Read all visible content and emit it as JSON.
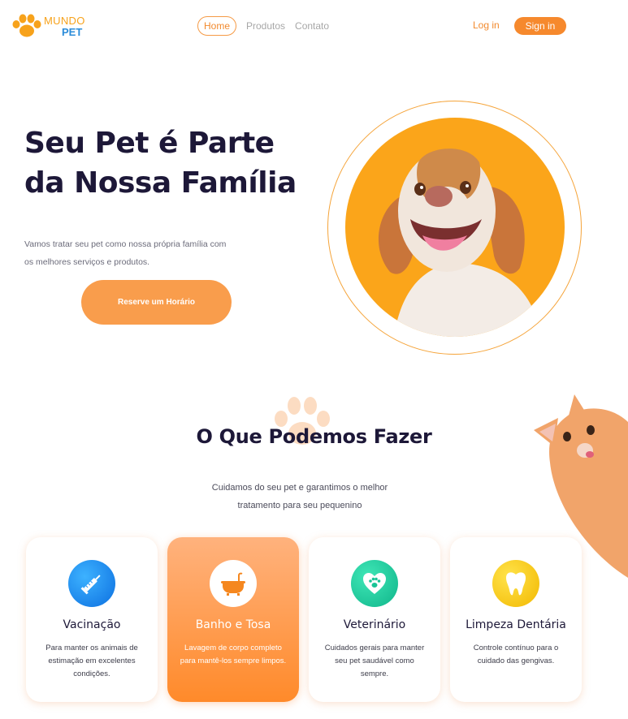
{
  "brand": {
    "line1": "MUNDO",
    "line2": "PET",
    "logo_icon": "paw-icon"
  },
  "nav": {
    "home": "Home",
    "products": "Produtos",
    "contact": "Contato"
  },
  "auth": {
    "login": "Log in",
    "signin": "Sign in"
  },
  "hero": {
    "title": "Seu Pet é Parte da Nossa Família",
    "text": "Vamos tratar seu pet como nossa própria família com os melhores serviços e produtos.",
    "button": "Reserve um Horário",
    "image": "smiling-dog-photo"
  },
  "services": {
    "title": "O Que Podemos Fazer",
    "subtitle": "Cuidamos do seu pet e garantimos o melhor tratamento para seu pequenino",
    "decoration": "orange-cat-peeking",
    "cards": [
      {
        "title": "Vacinação",
        "text": "Para manter os animais de estimação em excelentes condições.",
        "icon": "syringe-icon"
      },
      {
        "title": "Banho e Tosa",
        "text": "Lavagem de corpo completo para mantê-los sempre limpos.",
        "icon": "bathtub-icon"
      },
      {
        "title": "Veterinário",
        "text": "Cuidados gerais para manter seu pet saudável como sempre.",
        "icon": "heart-paw-icon"
      },
      {
        "title": "Limpeza Dentária",
        "text": "Controle contínuo para o cuidado das gengivas.",
        "icon": "tooth-icon"
      }
    ]
  },
  "colors": {
    "accent": "#f6892d",
    "orange": "#fba51a",
    "blue": "#1a8cf0",
    "green": "#19d3a0",
    "yellow": "#f5c400",
    "dark": "#1d1838"
  }
}
